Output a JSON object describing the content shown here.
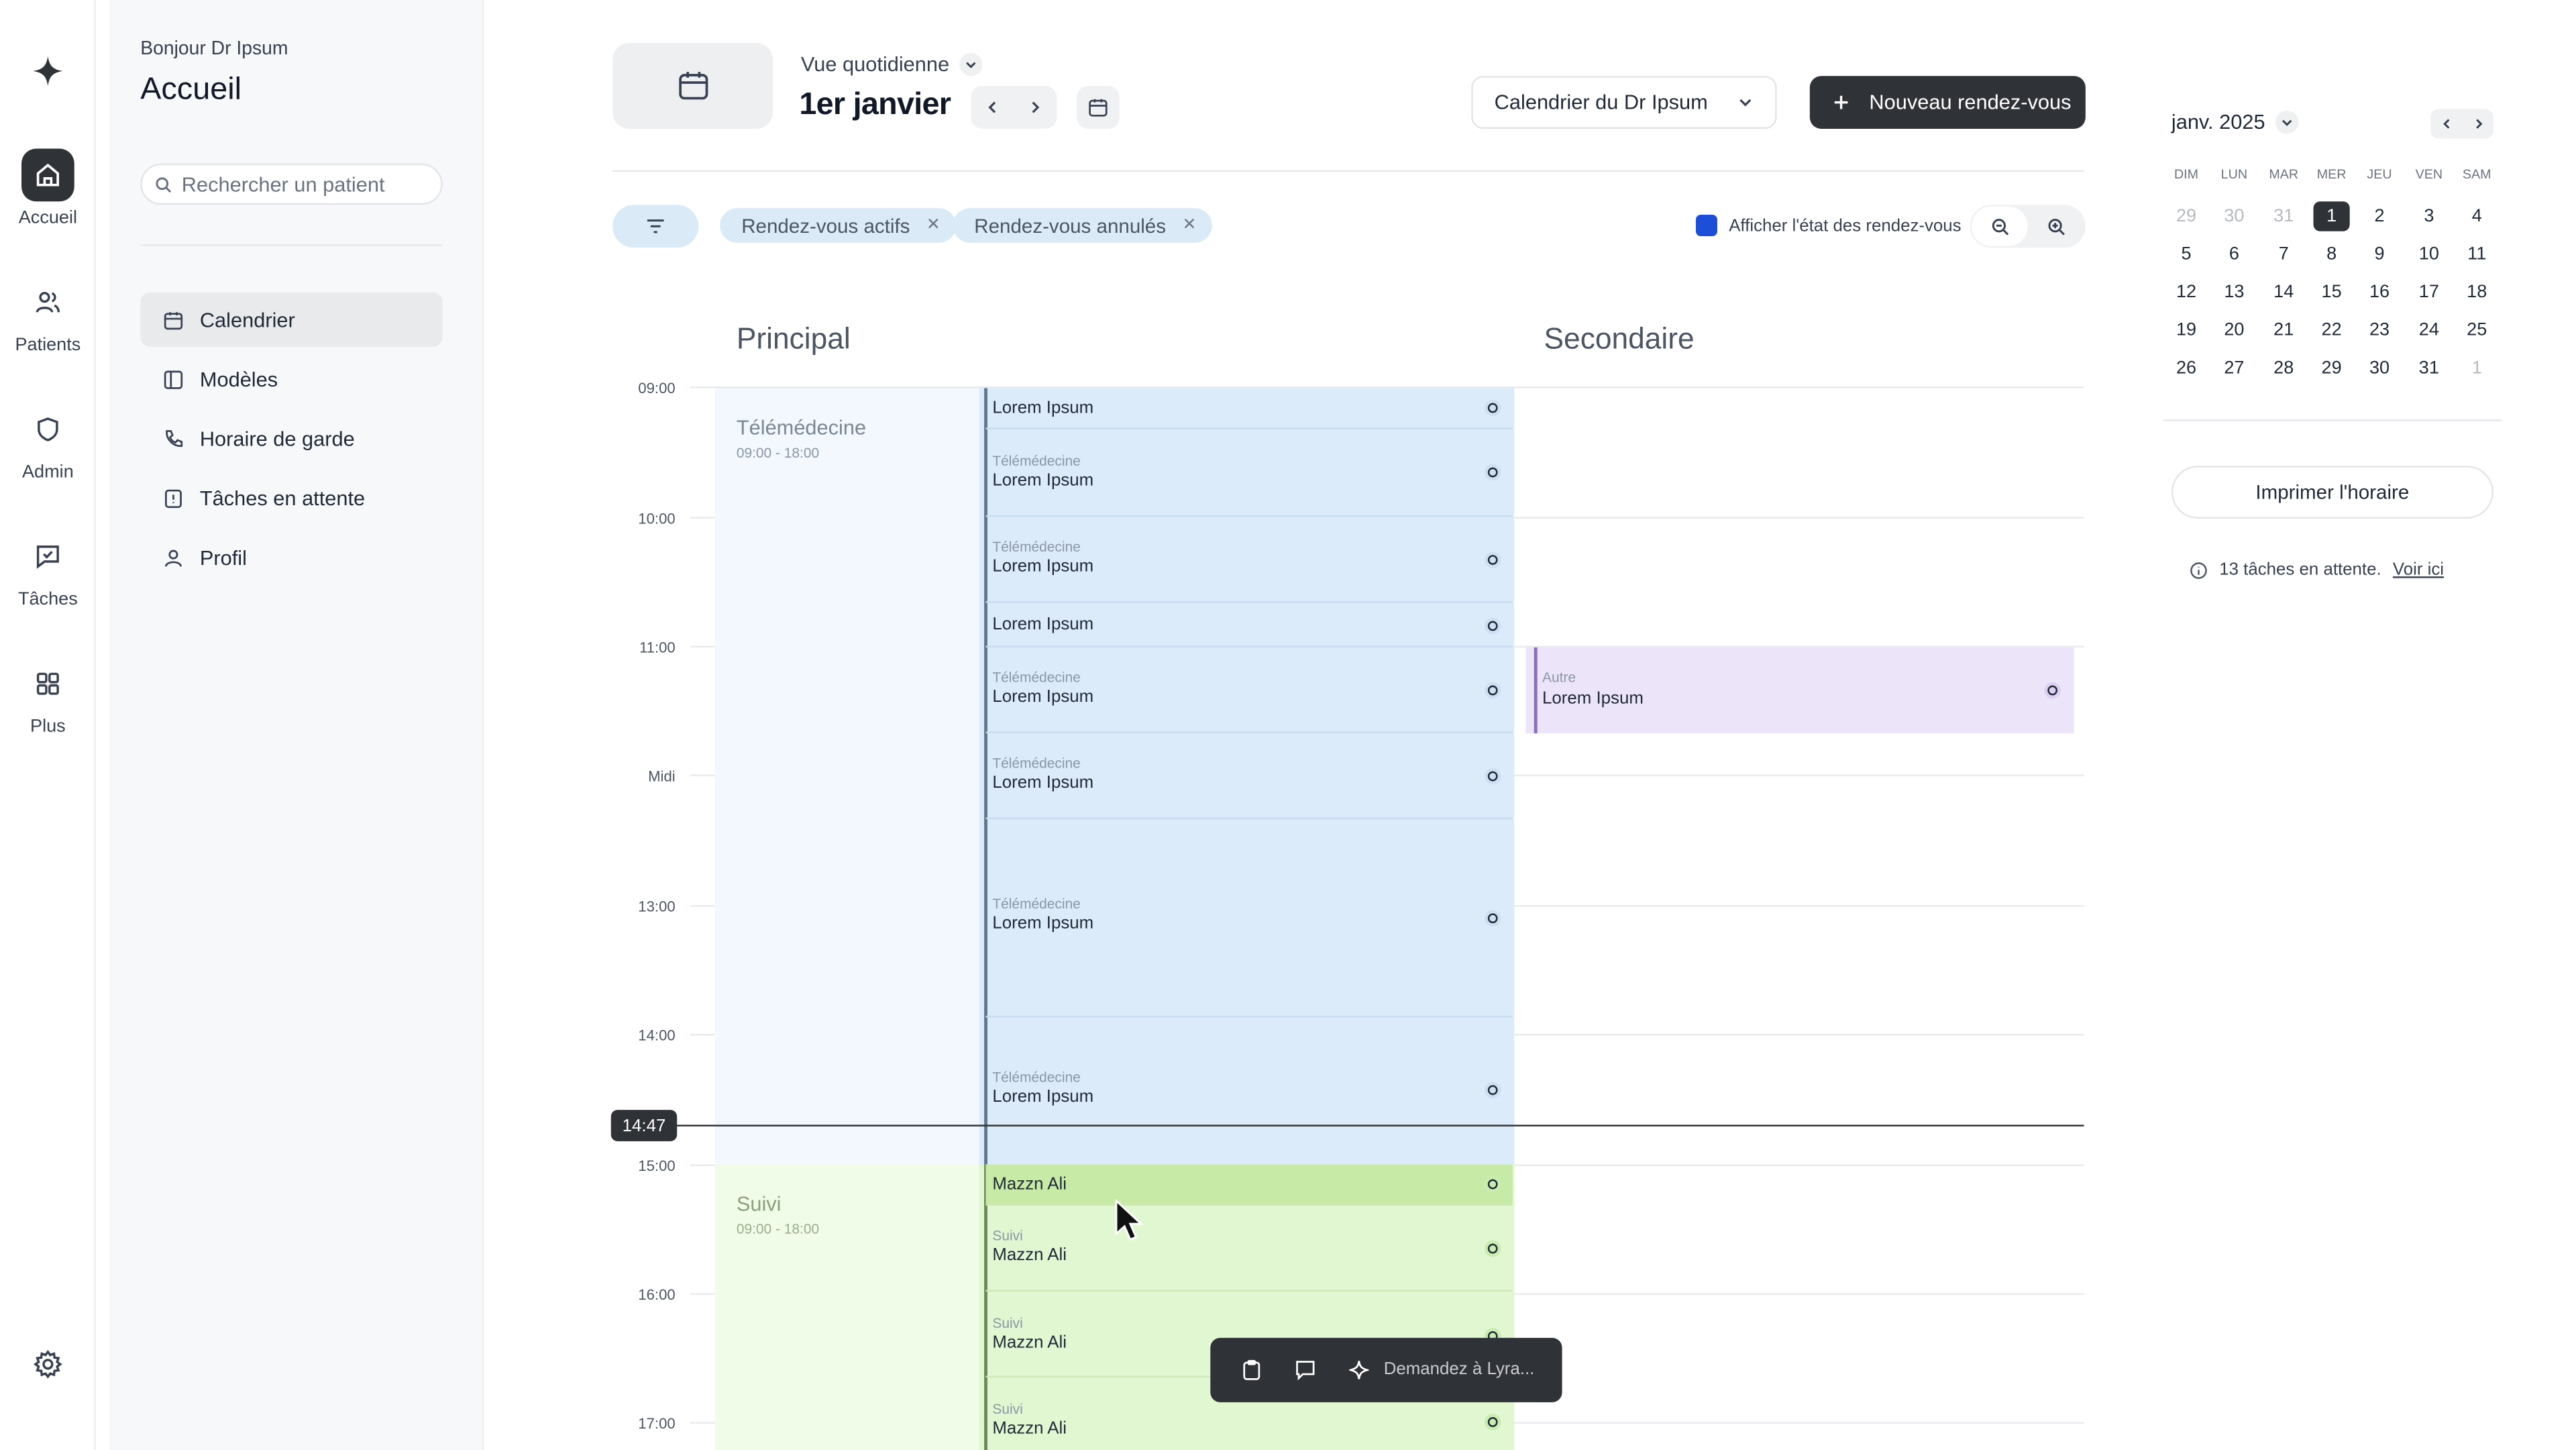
{
  "rail": {
    "items": [
      {
        "label": "Accueil",
        "icon": "home-icon"
      },
      {
        "label": "Patients",
        "icon": "users-icon"
      },
      {
        "label": "Admin",
        "icon": "shield-icon"
      },
      {
        "label": "Tâches",
        "icon": "tasks-icon"
      },
      {
        "label": "Plus",
        "icon": "grid-icon"
      }
    ]
  },
  "sidebar": {
    "greeting": "Bonjour Dr Ipsum",
    "title": "Accueil",
    "search_placeholder": "Rechercher un patient",
    "items": [
      {
        "label": "Calendrier",
        "icon": "calendar-icon"
      },
      {
        "label": "Modèles",
        "icon": "template-icon"
      },
      {
        "label": "Horaire de garde",
        "icon": "phone-icon"
      },
      {
        "label": "Tâches en attente",
        "icon": "pending-icon"
      },
      {
        "label": "Profil",
        "icon": "user-icon"
      }
    ]
  },
  "header": {
    "view_label": "Vue quotidienne",
    "date": "1er janvier",
    "calendar_select": "Calendrier du Dr Ipsum",
    "new_button": "Nouveau rendez-vous"
  },
  "filters": {
    "chips": [
      "Rendez-vous actifs",
      "Rendez-vous annulés"
    ],
    "show_status_label": "Afficher l'état des rendez-vous",
    "show_status_checked": true
  },
  "columns": {
    "primary": "Principal",
    "secondary": "Secondaire"
  },
  "hours": [
    "09:00",
    "10:00",
    "11:00",
    "Midi",
    "13:00",
    "14:00",
    "15:00",
    "16:00",
    "17:00"
  ],
  "now": "14:47",
  "blocks": [
    {
      "title": "Télémédecine",
      "hours": "09:00 - 18:00"
    },
    {
      "title": "Suivi",
      "hours": "09:00 - 18:00"
    }
  ],
  "appointments": [
    {
      "category": "",
      "name": "Lorem Ipsum"
    },
    {
      "category": "Télémédecine",
      "name": "Lorem Ipsum"
    },
    {
      "category": "Télémédecine",
      "name": "Lorem Ipsum"
    },
    {
      "category": "",
      "name": "Lorem Ipsum"
    },
    {
      "category": "Télémédecine",
      "name": "Lorem Ipsum"
    },
    {
      "category": "Télémédecine",
      "name": "Lorem Ipsum"
    },
    {
      "category": "Télémédecine",
      "name": "Lorem Ipsum"
    },
    {
      "category": "Télémédecine",
      "name": "Lorem Ipsum"
    },
    {
      "category": "",
      "name": "Mazzn Ali"
    },
    {
      "category": "Suivi",
      "name": "Mazzn Ali"
    },
    {
      "category": "Suivi",
      "name": "Mazzn Ali"
    },
    {
      "category": "Suivi",
      "name": "Mazzn Ali"
    }
  ],
  "secondary_appointment": {
    "category": "Autre",
    "name": "Lorem Ipsum"
  },
  "assistant": {
    "placeholder": "Demandez à Lyra..."
  },
  "mini_calendar": {
    "month": "janv. 2025",
    "weekdays": [
      "DIM",
      "LUN",
      "MAR",
      "MER",
      "JEU",
      "VEN",
      "SAM"
    ],
    "days": [
      "29",
      "30",
      "31",
      "1",
      "2",
      "3",
      "4",
      "5",
      "6",
      "7",
      "8",
      "9",
      "10",
      "11",
      "12",
      "13",
      "14",
      "15",
      "16",
      "17",
      "18",
      "19",
      "20",
      "21",
      "22",
      "23",
      "24",
      "25",
      "26",
      "27",
      "28",
      "29",
      "30",
      "31",
      "1"
    ],
    "selected": "1"
  },
  "print_button": "Imprimer l'horaire",
  "pending": {
    "text": "13 tâches en attente.",
    "link": "Voir ici"
  },
  "colors": {
    "accent": "#2f3237",
    "telemed": "#dcebf9",
    "suivi": "#e1f7d2",
    "other": "#ece4f9",
    "checkbox": "#1d4ed8"
  }
}
